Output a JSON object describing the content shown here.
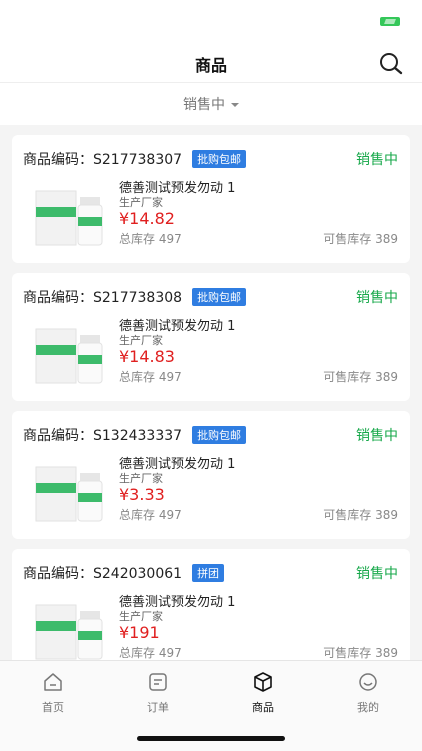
{
  "header": {
    "title": "商品"
  },
  "filter": {
    "label": "销售中"
  },
  "products": [
    {
      "code_label": "商品编码：",
      "code": "S217738307",
      "tag": "批购包邮",
      "status": "销售中",
      "name": "德善测试预发勿动 1",
      "maker": "生产厂家",
      "price": "¥14.82",
      "total_stock_label": "总库存",
      "total_stock": "497",
      "sale_stock_label": "可售库存",
      "sale_stock": "389"
    },
    {
      "code_label": "商品编码：",
      "code": "S217738308",
      "tag": "批购包邮",
      "status": "销售中",
      "name": "德善测试预发勿动 1",
      "maker": "生产厂家",
      "price": "¥14.83",
      "total_stock_label": "总库存",
      "total_stock": "497",
      "sale_stock_label": "可售库存",
      "sale_stock": "389"
    },
    {
      "code_label": "商品编码：",
      "code": "S132433337",
      "tag": "批购包邮",
      "status": "销售中",
      "name": "德善测试预发勿动 1",
      "maker": "生产厂家",
      "price": "¥3.33",
      "total_stock_label": "总库存",
      "total_stock": "497",
      "sale_stock_label": "可售库存",
      "sale_stock": "389"
    },
    {
      "code_label": "商品编码：",
      "code": "S242030061",
      "tag": "拼团",
      "status": "销售中",
      "name": "德善测试预发勿动 1",
      "maker": "生产厂家",
      "price": "¥191",
      "total_stock_label": "总库存",
      "total_stock": "497",
      "sale_stock_label": "可售库存",
      "sale_stock": "389"
    }
  ],
  "tabbar": {
    "items": [
      {
        "label": "首页",
        "icon": "home-icon",
        "active": false
      },
      {
        "label": "订单",
        "icon": "order-icon",
        "active": false
      },
      {
        "label": "商品",
        "icon": "box-icon",
        "active": true
      },
      {
        "label": "我的",
        "icon": "profile-icon",
        "active": false
      }
    ]
  },
  "colors": {
    "status_green": "#17a84a",
    "price_red": "#e02020",
    "tag_blue": "#2f7de1"
  }
}
